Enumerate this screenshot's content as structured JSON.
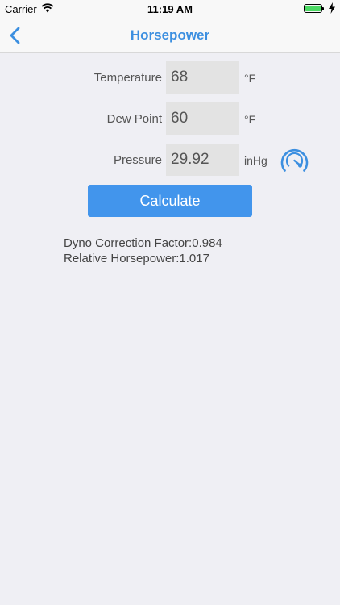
{
  "status_bar": {
    "carrier": "Carrier",
    "time": "11:19 AM",
    "battery_level": 1.0
  },
  "nav": {
    "title": "Horsepower"
  },
  "form": {
    "temperature": {
      "label": "Temperature",
      "value": "68",
      "unit": "°F"
    },
    "dew_point": {
      "label": "Dew Point",
      "value": "60",
      "unit": "°F"
    },
    "pressure": {
      "label": "Pressure",
      "value": "29.92",
      "unit": "inHg"
    }
  },
  "calculate_label": "Calculate",
  "results": {
    "dyno_correction": "Dyno Correction Factor:0.984",
    "relative_hp": "Relative Horsepower:1.017"
  },
  "colors": {
    "accent": "#3c8fe0",
    "button": "#4295ec",
    "background": "#efeff4",
    "field": "#e3e3e3",
    "battery": "#4cd964"
  }
}
